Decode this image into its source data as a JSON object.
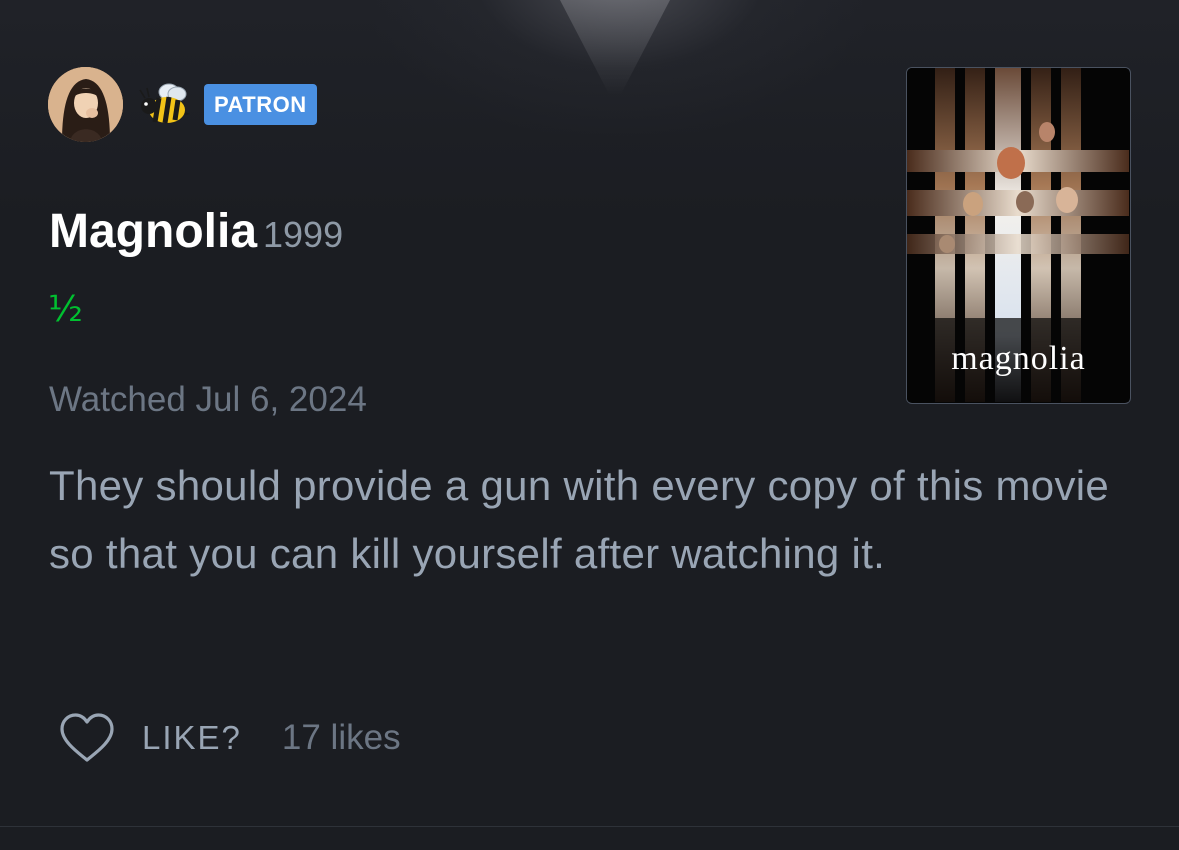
{
  "review": {
    "badge_label": "PATRON",
    "film": {
      "title": "Magnolia",
      "year": "1999",
      "poster_title": "magnolia"
    },
    "rating": "½",
    "rating_value": 0.5,
    "rating_max": 5,
    "watched": "Watched Jul 6, 2024",
    "text": "They should provide a gun with every copy of this movie so that you can kill yourself after watching it."
  },
  "actions": {
    "like_label": "LIKE?",
    "likes_count": "17 likes"
  },
  "colors": {
    "background": "#1b1d22",
    "rating_green": "#00c030",
    "patron_blue": "#4a90e2",
    "muted_text": "#6c7684",
    "body_text": "#99a5b4"
  },
  "icons": {
    "avatar": "user-avatar",
    "badge_emoji": "bee-icon",
    "like": "heart-outline-icon"
  }
}
